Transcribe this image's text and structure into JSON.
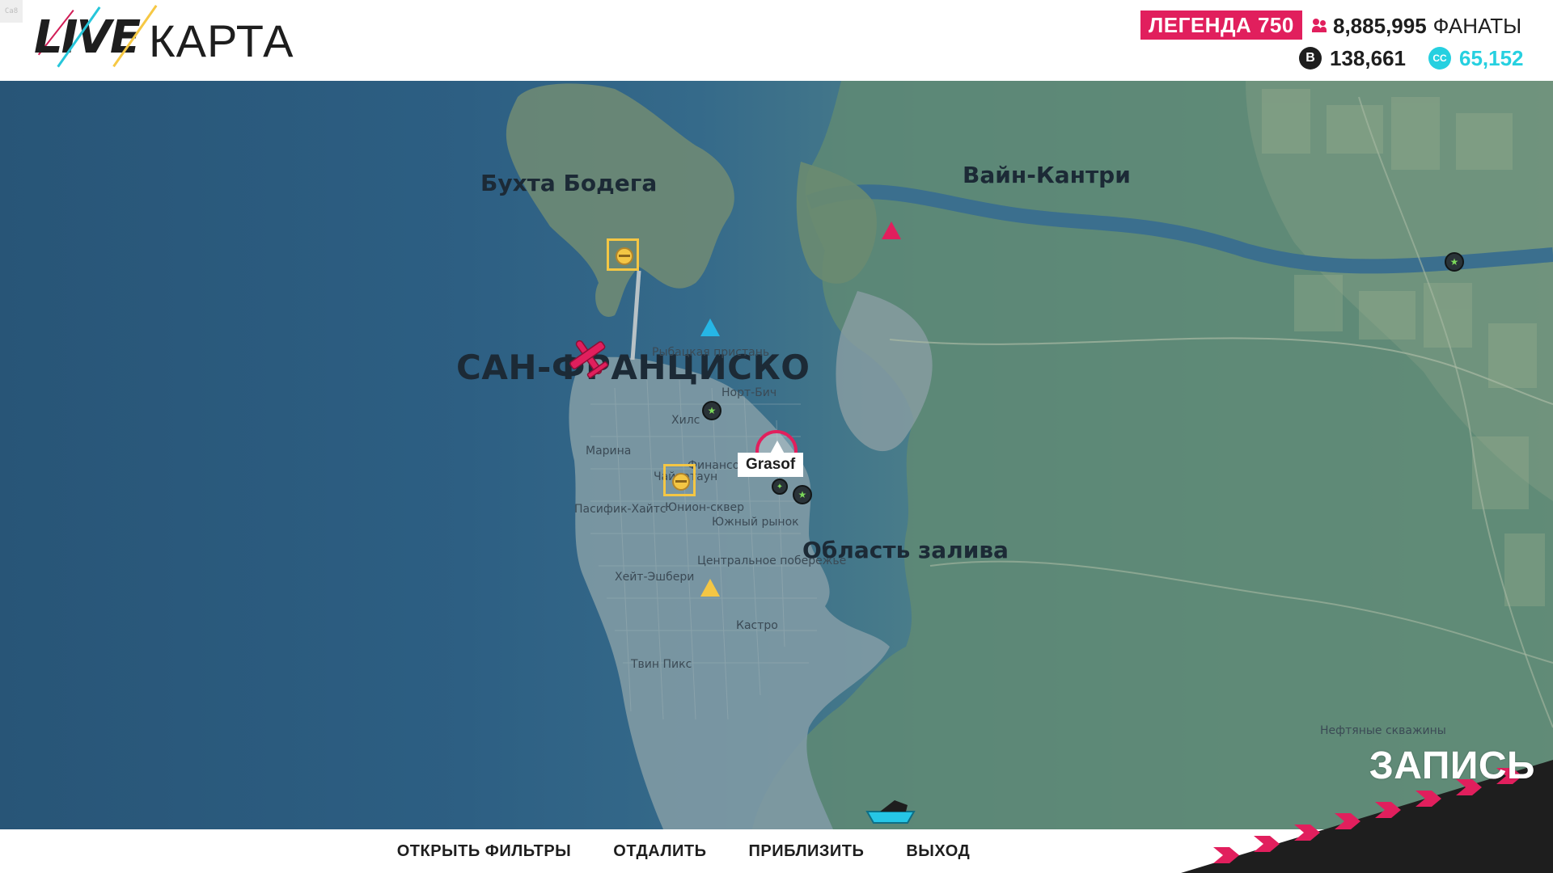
{
  "header": {
    "corner_tag": "Ca8",
    "logo_live": "LIVE",
    "logo_title": "КАРТА",
    "legend_badge": "ЛЕГЕНДА 750",
    "fans_count": "8,885,995",
    "fans_label": "ФАНАТЫ",
    "credits_icon": "B",
    "credits": "138,661",
    "cc_icon": "CC",
    "cc_points": "65,152"
  },
  "map": {
    "regions": {
      "bodega": "Бухта Бодега",
      "wine": "Вайн-Кантри",
      "bay": "Область залива",
      "oil": "Нефтяные скважины"
    },
    "city": "САН-ФРАНЦИСКО",
    "districts": {
      "north_beach": "Норт-Бич",
      "hills": "Хилс",
      "marina": "Марина",
      "chinatown": "Чайнатаун",
      "financial": "Финансовый",
      "pacific_heights": "Пасифик-Хайтс",
      "union_square": "Юнион-сквер",
      "south_market": "Южный рынок",
      "central": "Центральное побережье",
      "haight": "Хейт-Эшбери",
      "castro": "Кастро",
      "twin_peaks": "Твин Пикс",
      "fisherman": "Рыбацкая пристань"
    },
    "player_name": "Grasof",
    "icons": {
      "target": "target-icon",
      "race_red": "race-triangle-icon",
      "race_blue": "race-triangle-icon",
      "race_yellow": "race-triangle-icon",
      "cluster": "activity-cluster-icon",
      "plane": "plane-icon",
      "boat": "boat-icon",
      "player": "player-arrow-icon"
    }
  },
  "record": {
    "label": "ЗАПИСЬ"
  },
  "footer": {
    "open_filters": "ОТКРЫТЬ ФИЛЬТРЫ",
    "zoom_out": "ОТДАЛИТЬ",
    "zoom_in": "ПРИБЛИЗИТЬ",
    "exit": "ВЫХОД"
  },
  "colors": {
    "accent": "#e11f5d",
    "cyan": "#26d0e0",
    "gold": "#f4c644"
  }
}
